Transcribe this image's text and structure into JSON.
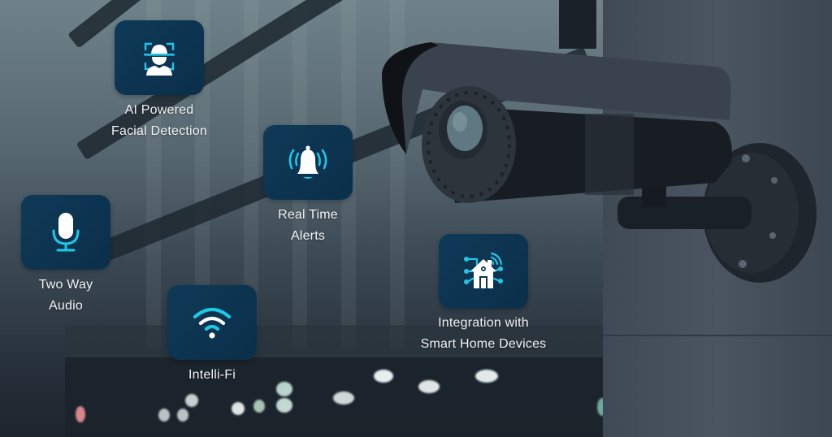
{
  "colors": {
    "tile_bg": "#0c3350",
    "icon_accent": "#1fc7e6",
    "icon_primary": "#ffffff",
    "label_text": "#f2f4f5"
  },
  "features": [
    {
      "id": "facial-detection",
      "icon": "face-scan-icon",
      "label_line1": "AI Powered",
      "label_line2": "Facial Detection"
    },
    {
      "id": "real-time-alerts",
      "icon": "bell-icon",
      "label_line1": "Real Time",
      "label_line2": "Alerts"
    },
    {
      "id": "two-way-audio",
      "icon": "microphone-icon",
      "label_line1": "Two Way",
      "label_line2": "Audio"
    },
    {
      "id": "intelli-fi",
      "icon": "wifi-icon",
      "label_line1": "Intelli-Fi",
      "label_line2": ""
    },
    {
      "id": "smart-home-integration",
      "icon": "smart-home-icon",
      "label_line1": "Integration with",
      "label_line2": "Smart Home Devices"
    }
  ],
  "background": {
    "subject": "security-camera-photo"
  }
}
